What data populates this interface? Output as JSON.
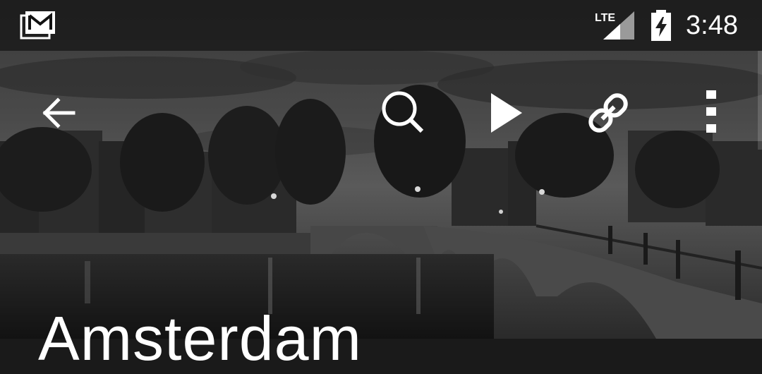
{
  "status_bar": {
    "time": "3:48",
    "network_label": "LTE",
    "notification_icon": "gmail-icon",
    "signal_icon": "cell-signal-icon",
    "battery_icon": "battery-charging-icon"
  },
  "toolbar": {
    "icons": [
      "back-arrow-icon",
      "search-icon",
      "play-icon",
      "link-icon",
      "overflow-menu-icon"
    ]
  },
  "hero": {
    "title": "Amsterdam"
  }
}
